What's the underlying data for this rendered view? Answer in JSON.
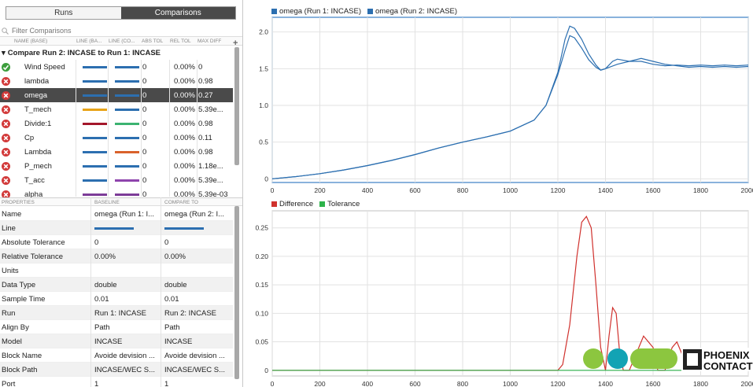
{
  "tabs": [
    {
      "label": "Runs",
      "active": false
    },
    {
      "label": "Comparisons",
      "active": true
    }
  ],
  "filter": {
    "placeholder": "Filter Comparisons"
  },
  "columns": {
    "name": "NAME (BASE)",
    "line_base": "LINE (BA...",
    "line_compare": "LINE (CO...",
    "abs_tol": "ABS TOL",
    "rel_tol": "REL TOL",
    "max_diff": "MAX DIFF",
    "add_icon": "+"
  },
  "group": {
    "label": "Compare Run 2: INCASE to Run 1: INCASE",
    "expand_icon": "▾"
  },
  "signals": [
    {
      "status": "pass",
      "name": "Wind Speed",
      "line1": "#2c6fb0",
      "line2": "#2c6fb0",
      "abs_tol": "0",
      "rel_tol": "0.00%",
      "max_diff": "0"
    },
    {
      "status": "fail",
      "name": "lambda",
      "line1": "#2c6fb0",
      "line2": "#2c6fb0",
      "abs_tol": "0",
      "rel_tol": "0.00%",
      "max_diff": "0.98"
    },
    {
      "status": "fail",
      "name": "omega",
      "line1": "#2c6fb0",
      "line2": "#2c6fb0",
      "abs_tol": "0",
      "rel_tol": "0.00%",
      "max_diff": "0.27",
      "selected": true
    },
    {
      "status": "fail",
      "name": "T_mech",
      "line1": "#e8a317",
      "line2": "#2c6fb0",
      "abs_tol": "0",
      "rel_tol": "0.00%",
      "max_diff": "5.39e..."
    },
    {
      "status": "fail",
      "name": "Divide:1",
      "line1": "#a3162a",
      "line2": "#3cb371",
      "abs_tol": "0",
      "rel_tol": "0.00%",
      "max_diff": "0.98"
    },
    {
      "status": "fail",
      "name": "Cp",
      "line1": "#2c6fb0",
      "line2": "#2c6fb0",
      "abs_tol": "0",
      "rel_tol": "0.00%",
      "max_diff": "0.11"
    },
    {
      "status": "fail",
      "name": "Lambda",
      "line1": "#2c6fb0",
      "line2": "#d9622b",
      "abs_tol": "0",
      "rel_tol": "0.00%",
      "max_diff": "0.98"
    },
    {
      "status": "fail",
      "name": "P_mech",
      "line1": "#2c6fb0",
      "line2": "#2c6fb0",
      "abs_tol": "0",
      "rel_tol": "0.00%",
      "max_diff": "1.18e..."
    },
    {
      "status": "fail",
      "name": "T_acc",
      "line1": "#2c6fb0",
      "line2": "#8e44ad",
      "abs_tol": "0",
      "rel_tol": "0.00%",
      "max_diff": "5.39e..."
    },
    {
      "status": "fail",
      "name": "alpha",
      "line1": "#7d3c98",
      "line2": "#7d3c98",
      "abs_tol": "0",
      "rel_tol": "0.00%",
      "max_diff": "5.39e-03"
    }
  ],
  "properties": {
    "headers": {
      "key": "PROPERTIES",
      "baseline": "BASELINE",
      "compare": "COMPARE TO"
    },
    "rows": [
      {
        "key": "Name",
        "baseline": "omega (Run 1: I...",
        "compare": "omega (Run 2: I..."
      },
      {
        "key": "Line",
        "baseline": "",
        "compare": "",
        "is_line": true
      },
      {
        "key": "Absolute Tolerance",
        "baseline": "0",
        "compare": "0"
      },
      {
        "key": "Relative Tolerance",
        "baseline": "0.00%",
        "compare": "0.00%"
      },
      {
        "key": "Units",
        "baseline": "",
        "compare": ""
      },
      {
        "key": "Data Type",
        "baseline": "double",
        "compare": "double"
      },
      {
        "key": "Sample Time",
        "baseline": "0.01",
        "compare": "0.01"
      },
      {
        "key": "Run",
        "baseline": "Run 1: INCASE",
        "compare": "Run 2: INCASE"
      },
      {
        "key": "Align By",
        "baseline": "Path",
        "compare": "Path"
      },
      {
        "key": "Model",
        "baseline": "INCASE",
        "compare": "INCASE"
      },
      {
        "key": "Block Name",
        "baseline": "Avoide devision ...",
        "compare": "Avoide devision ..."
      },
      {
        "key": "Block Path",
        "baseline": "INCASE/WEC S...",
        "compare": "INCASE/WEC S..."
      },
      {
        "key": "Port",
        "baseline": "1",
        "compare": "1"
      }
    ]
  },
  "colors": {
    "blue": "#2c6fb0",
    "red": "#d0312d",
    "green": "#2db34a",
    "selected_row": "#4a4a4a"
  },
  "watermark": {
    "text": "PHOENIX CONTACT"
  },
  "chart_data": [
    {
      "type": "line",
      "title": "",
      "xlabel": "",
      "ylabel": "",
      "xlim": [
        0,
        2000
      ],
      "ylim": [
        -0.05,
        2.2
      ],
      "xticks": [
        "0",
        "200",
        "400",
        "600",
        "800",
        "1000",
        "1200",
        "1400",
        "1600",
        "1800",
        "2000"
      ],
      "yticks": [
        "0",
        "0.5",
        "1.0",
        "1.5",
        "2.0"
      ],
      "grid": true,
      "legend": "top-left",
      "series": [
        {
          "name": "omega (Run 1: INCASE)",
          "color": "#2c6fb0",
          "x": [
            0,
            100,
            200,
            300,
            400,
            500,
            600,
            700,
            800,
            900,
            1000,
            1100,
            1150,
            1200,
            1230,
            1250,
            1270,
            1300,
            1330,
            1360,
            1380,
            1400,
            1450,
            1500,
            1550,
            1600,
            1650,
            1700,
            1750,
            1800,
            1850,
            1900,
            1950,
            2000
          ],
          "y": [
            0,
            0.03,
            0.07,
            0.12,
            0.18,
            0.25,
            0.33,
            0.42,
            0.5,
            0.57,
            0.65,
            0.8,
            1.0,
            1.42,
            1.75,
            1.95,
            1.92,
            1.78,
            1.62,
            1.52,
            1.48,
            1.5,
            1.56,
            1.6,
            1.6,
            1.56,
            1.54,
            1.55,
            1.54,
            1.55,
            1.54,
            1.55,
            1.54,
            1.55
          ]
        },
        {
          "name": "omega (Run 2: INCASE)",
          "color": "#2c6fb0",
          "x": [
            0,
            100,
            200,
            300,
            400,
            500,
            600,
            700,
            800,
            900,
            1000,
            1100,
            1150,
            1200,
            1230,
            1250,
            1270,
            1300,
            1330,
            1360,
            1380,
            1400,
            1430,
            1450,
            1500,
            1550,
            1600,
            1650,
            1700,
            1750,
            1800,
            1850,
            1900,
            1950,
            2000
          ],
          "y": [
            0,
            0.03,
            0.07,
            0.12,
            0.18,
            0.25,
            0.33,
            0.42,
            0.5,
            0.57,
            0.65,
            0.8,
            1.0,
            1.45,
            1.9,
            2.08,
            2.05,
            1.9,
            1.7,
            1.55,
            1.48,
            1.5,
            1.6,
            1.63,
            1.6,
            1.64,
            1.6,
            1.56,
            1.54,
            1.52,
            1.53,
            1.52,
            1.53,
            1.52,
            1.53
          ]
        }
      ]
    },
    {
      "type": "line",
      "title": "",
      "xlabel": "",
      "ylabel": "",
      "xlim": [
        0,
        2000
      ],
      "ylim": [
        -0.01,
        0.28
      ],
      "xticks": [
        "0",
        "200",
        "400",
        "600",
        "800",
        "1000",
        "1200",
        "1400",
        "1600",
        "1800",
        "2000"
      ],
      "yticks": [
        "0",
        "0.05",
        "0.10",
        "0.15",
        "0.20",
        "0.25"
      ],
      "grid": true,
      "legend": "top-left",
      "series": [
        {
          "name": "Difference",
          "color": "#d0312d",
          "x": [
            0,
            1200,
            1220,
            1250,
            1280,
            1300,
            1320,
            1340,
            1360,
            1380,
            1400,
            1415,
            1430,
            1445,
            1460,
            1475,
            1500,
            1520,
            1560,
            1600,
            1620,
            1650,
            1680,
            1700,
            1730,
            1760,
            1790,
            1820,
            1850,
            1900,
            1950,
            2000
          ],
          "y": [
            0,
            0,
            0.01,
            0.08,
            0.2,
            0.26,
            0.27,
            0.25,
            0.15,
            0.04,
            0.0,
            0.06,
            0.11,
            0.1,
            0.03,
            0.0,
            0.0,
            0.02,
            0.06,
            0.04,
            0.0,
            0.0,
            0.04,
            0.05,
            0.02,
            0.0,
            0.015,
            0.02,
            0.01,
            0.005,
            0.01,
            0.005
          ]
        },
        {
          "name": "Tolerance",
          "color": "#2db34a",
          "x": [
            0,
            2000
          ],
          "y": [
            0,
            0
          ]
        }
      ]
    }
  ]
}
